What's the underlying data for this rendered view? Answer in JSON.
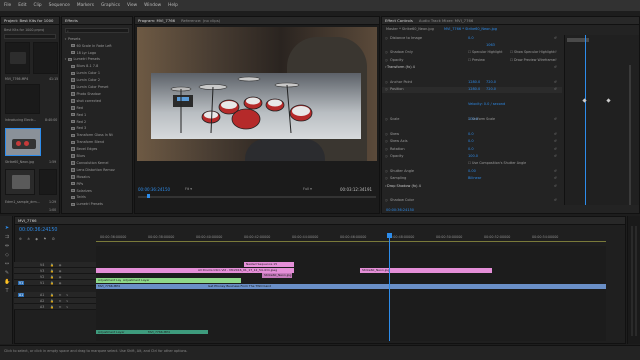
{
  "menu": [
    "File",
    "Edit",
    "Clip",
    "Sequence",
    "Markers",
    "Graphics",
    "View",
    "Window",
    "Help"
  ],
  "project": {
    "tab_title": "Project: Best Kits for 1000",
    "tab_effects": "Effects",
    "bin_path": "Best Kits for 1000.prproj",
    "items": [
      {
        "label": "MVI_7766.MP4",
        "dur": "41:15"
      },
      {
        "label": "Introducing Electr...",
        "dur": "8:40:00"
      },
      {
        "label": "Strike60_Neon.jpg",
        "dur": "1:59"
      },
      {
        "label": "Edrm1_sample_drm...",
        "dur": "1:29"
      },
      {
        "label": "",
        "dur": "1:00"
      }
    ]
  },
  "effects_list": {
    "search_placeholder": "",
    "items": [
      {
        "label": "Presets",
        "fold": "▾",
        "box": false
      },
      {
        "label": "60 Scale In Fade Left",
        "fold": "",
        "box": true
      },
      {
        "label": "18 Lyr Logo",
        "fold": "",
        "box": true
      },
      {
        "label": "Lumetri Presets",
        "fold": "▾",
        "box": true
      },
      {
        "label": "Blurs 8-1 7-8",
        "fold": "",
        "box": true
      },
      {
        "label": "Lumin Color 1",
        "fold": "",
        "box": true
      },
      {
        "label": "Lumin Color 2",
        "fold": "",
        "box": true
      },
      {
        "label": "Lumin Color Preset",
        "fold": "",
        "box": true
      },
      {
        "label": "Photo Shadow",
        "fold": "",
        "box": true
      },
      {
        "label": "shot corrected",
        "fold": "",
        "box": true
      },
      {
        "label": "Red",
        "fold": "",
        "box": true
      },
      {
        "label": "Red 1",
        "fold": "",
        "box": true
      },
      {
        "label": "Red 2",
        "fold": "",
        "box": true
      },
      {
        "label": "Red 3",
        "fold": "",
        "box": true
      },
      {
        "label": "Transform Glass In Nt",
        "fold": "",
        "box": true
      },
      {
        "label": "Transform Blend",
        "fold": "",
        "box": true
      },
      {
        "label": "Bevel Edges",
        "fold": "",
        "box": true
      },
      {
        "label": "Blurs",
        "fold": "",
        "box": true
      },
      {
        "label": "Convolution Kernel",
        "fold": "",
        "box": true
      },
      {
        "label": "Lens Distortion Remov",
        "fold": "",
        "box": true
      },
      {
        "label": "Mosaics",
        "fold": "",
        "box": true
      },
      {
        "label": "PiPs",
        "fold": "",
        "box": true
      },
      {
        "label": "Solarizes",
        "fold": "",
        "box": true
      },
      {
        "label": "Twirls",
        "fold": "",
        "box": true
      },
      {
        "label": "Lumetri Presets",
        "fold": "",
        "box": true
      }
    ]
  },
  "program": {
    "tab_title": "Program: MVI_7766",
    "tab_ref": "Reference: (no clips)",
    "timecode": "00:00:36:24150",
    "fit": "Fit",
    "quality": "Full",
    "duration": "00:03:12:34191"
  },
  "effect_controls": {
    "tab_title": "Effect Controls",
    "tab_mixer": "Audio Track Mixer: MVI_7766",
    "master": "Master * Strike60_Neon.jpg",
    "clip": "MVI_7766 * Strike60_Neon.jpg",
    "rows": [
      {
        "label": "Distance to Image",
        "v1": "0.0",
        "v2": "",
        "section": false
      },
      {
        "label": "",
        "v1": "",
        "v2": "1063",
        "section": false
      },
      {
        "label": "Shadow Only",
        "v1": "",
        "v2": "",
        "section": false
      },
      {
        "label": "Opacity",
        "v1": "",
        "v2": "",
        "section": false
      },
      {
        "label": "Transform (fx) 4",
        "v1": "",
        "v2": "",
        "section": true
      },
      {
        "label": "",
        "v1": "",
        "v2": "",
        "section": false
      },
      {
        "label": "Anchor Point",
        "v1": "1280.0",
        "v2": "720.0",
        "section": false
      },
      {
        "label": "Position",
        "v1": "1280.0",
        "v2": "720.0",
        "section": false
      },
      {
        "label": "",
        "v1": "",
        "v2": "",
        "section": false
      },
      {
        "label": "",
        "v1": "Velocity: 0.0 / second",
        "v2": "",
        "section": false
      },
      {
        "label": "",
        "v1": "",
        "v2": "",
        "section": false
      },
      {
        "label": "Scale",
        "v1": "100.0",
        "v2": "",
        "section": false
      },
      {
        "label": "",
        "v1": "",
        "v2": "",
        "section": false
      },
      {
        "label": "Skew",
        "v1": "0.0",
        "v2": "",
        "section": false
      },
      {
        "label": "Skew Axis",
        "v1": "0.0",
        "v2": "",
        "section": false
      },
      {
        "label": "Rotation",
        "v1": "0.0",
        "v2": "",
        "section": false
      },
      {
        "label": "Opacity",
        "v1": "100.0",
        "v2": "",
        "section": false
      },
      {
        "label": "",
        "v1": "",
        "v2": "",
        "section": false
      },
      {
        "label": "Shutter Angle",
        "v1": "0.00",
        "v2": "",
        "section": false
      },
      {
        "label": "Sampling",
        "v1": "Bilinear",
        "v2": "",
        "section": false
      },
      {
        "label": "Drop Shadow (fx) 4",
        "v1": "",
        "v2": "",
        "section": true
      },
      {
        "label": "",
        "v1": "",
        "v2": "",
        "section": false
      },
      {
        "label": "Shadow Color",
        "v1": "",
        "v2": "",
        "section": false
      }
    ],
    "checks": [
      "Specular Highlight",
      "Show Specular Highlight",
      "Preview",
      "Draw Preview Wireframe",
      "Uniform Scale",
      "Use Composition's Shutter Angle"
    ],
    "footer_timecode": "00:00:36:24150"
  },
  "timeline": {
    "tab_title": "MVI_7766",
    "timecode": "00:00:36:24150",
    "ruler": [
      "00:00:36:00000",
      "00:00:38:00000",
      "00:00:40:00000",
      "00:00:42:00000",
      "00:00:44:00000",
      "00:00:46:00000",
      "00:00:48:00000",
      "00:00:50:00000",
      "00:00:52:00000",
      "00:00:54:00000"
    ],
    "tracks": [
      {
        "name": "V4",
        "target": ""
      },
      {
        "name": "V3",
        "target": ""
      },
      {
        "name": "V2",
        "target": ""
      },
      {
        "name": "V1",
        "target": "V1"
      },
      {
        "name": "A1",
        "target": "A1"
      },
      {
        "name": "A2",
        "target": ""
      },
      {
        "name": "A3",
        "target": ""
      }
    ],
    "clips": {
      "c1": "Nested Sequence 15",
      "c2": "All Drums Intro Vid - MC2016_01_17_12_54.drm.jpeg",
      "c3": "Strike60_Neon.jpg",
      "c4": "Strike60_Neon.jpg",
      "c5": "Adjustment Layer",
      "c6": "Adjustment Layer",
      "c7": "MVI_7766.MP4",
      "c8": "Get Phoney Business From The TWO band",
      "c9": "Adjustment Layer",
      "c10": "MVI_7766.MP4"
    }
  },
  "status": "Click to select, or click in empty space and drag to marquee select. Use Shift, Alt, and Ctrl for other options.",
  "colors": {
    "accent": "#2d8ceb",
    "clip_pink": "#e58fd8",
    "clip_green": "#8fd98a",
    "clip_blue": "#6a8fc7"
  }
}
